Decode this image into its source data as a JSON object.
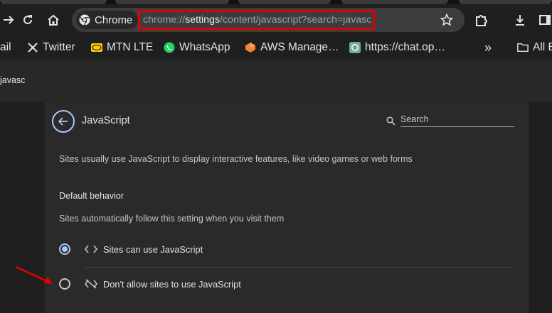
{
  "browser": {
    "chip_label": "Chrome",
    "url_scheme": "chrome://",
    "url_host": "settings",
    "url_path": "/content/javascript?search=javasc"
  },
  "bookmarks": [
    {
      "label": "ail",
      "icon": "mail-icon"
    },
    {
      "label": "Twitter",
      "icon": "x-logo-icon"
    },
    {
      "label": "MTN LTE",
      "icon": "mtn-logo-icon"
    },
    {
      "label": "WhatsApp",
      "icon": "whatsapp-icon"
    },
    {
      "label": "AWS Manage…",
      "icon": "aws-icon"
    },
    {
      "label": "https://chat.op…",
      "icon": "openai-icon"
    },
    {
      "label": "»",
      "icon": "overflow-chevron-icon"
    },
    {
      "label": "All B",
      "icon": "folder-icon"
    }
  ],
  "settings_header": {
    "search_value": "javasc"
  },
  "card": {
    "title": "JavaScript",
    "search_placeholder": "Search",
    "description": "Sites usually use JavaScript to display interactive features, like video games or web forms",
    "section_title": "Default behavior",
    "section_subtitle": "Sites automatically follow this setting when you visit them",
    "options": [
      {
        "label": "Sites can use JavaScript",
        "checked": true,
        "icon": "code-brackets-icon"
      },
      {
        "label": "Don't allow sites to use JavaScript",
        "checked": false,
        "icon": "code-off-icon"
      }
    ]
  },
  "colors": {
    "accent": "#a8c7fa",
    "highlight_annotation": "#e10000"
  }
}
